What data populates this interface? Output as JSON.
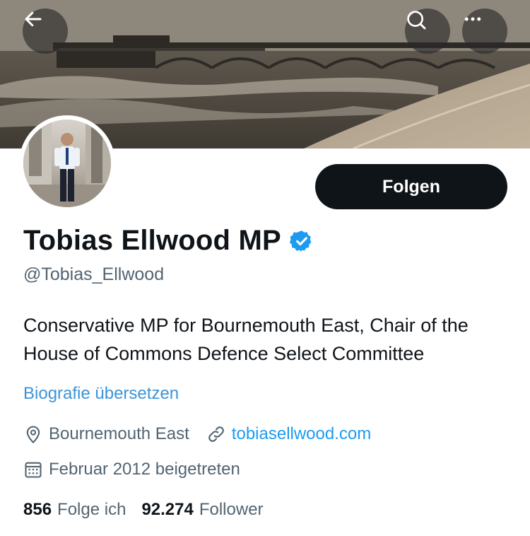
{
  "header": {
    "back_icon": "arrow-left-icon",
    "search_icon": "search-icon",
    "more_icon": "more-horizontal-icon"
  },
  "profile": {
    "display_name": "Tobias Ellwood MP",
    "verified": true,
    "handle": "@Tobias_Ellwood",
    "bio": "Conservative MP for Bournemouth East, Chair of the House of Commons Defence Select Committee",
    "translate_bio": "Biografie übersetzen",
    "follow_label": "Folgen",
    "location": "Bournemouth East",
    "website": "tobiasellwood.com",
    "joined": "Februar 2012 beigetreten",
    "following_count": "856",
    "following_label": "Folge ich",
    "followers_count": "92.274",
    "followers_label": "Follower"
  },
  "colors": {
    "link": "#1d9bf0",
    "verified": "#1d9bf0",
    "secondary_text": "#536471",
    "primary_text": "#0f1419",
    "follow_button": "#0f1419"
  }
}
